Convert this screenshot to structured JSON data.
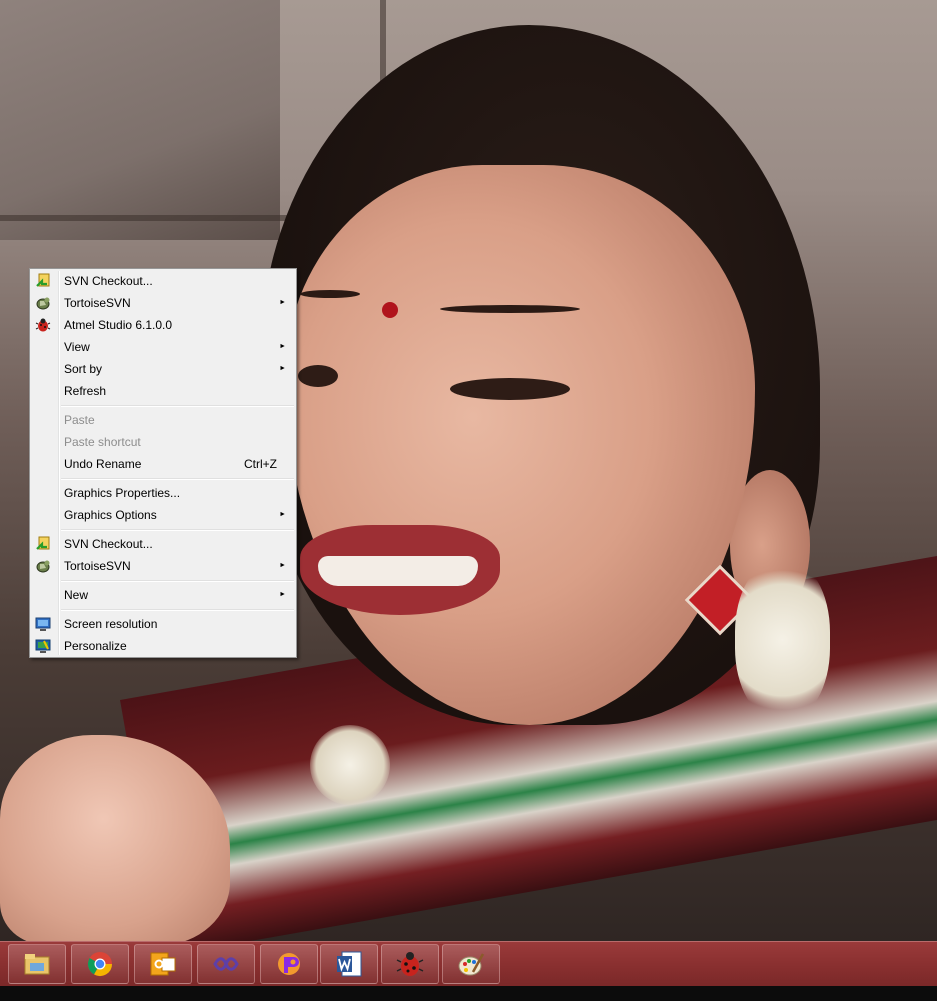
{
  "context_menu": {
    "items": [
      {
        "label": "SVN Checkout...",
        "icon": "svn-checkout-icon",
        "submenu": false
      },
      {
        "label": "TortoiseSVN",
        "icon": "tortoisesvn-icon",
        "submenu": true
      },
      {
        "label": "Atmel Studio 6.1.0.0",
        "icon": "atmel-studio-icon",
        "submenu": false
      },
      {
        "label": "View",
        "submenu": true
      },
      {
        "label": "Sort by",
        "submenu": true
      },
      {
        "label": "Refresh",
        "submenu": false
      },
      {
        "label": "Paste",
        "disabled": true
      },
      {
        "label": "Paste shortcut",
        "disabled": true
      },
      {
        "label": "Undo Rename",
        "shortcut": "Ctrl+Z"
      },
      {
        "label": "Graphics Properties...",
        "submenu": false
      },
      {
        "label": "Graphics Options",
        "submenu": true
      },
      {
        "label": "SVN Checkout...",
        "icon": "svn-checkout-icon",
        "submenu": false
      },
      {
        "label": "TortoiseSVN",
        "icon": "tortoisesvn-icon",
        "submenu": true
      },
      {
        "label": "New",
        "submenu": true
      },
      {
        "label": "Screen resolution",
        "icon": "screen-resolution-icon",
        "submenu": false
      },
      {
        "label": "Personalize",
        "icon": "personalize-icon",
        "submenu": false
      }
    ],
    "submenu_arrow": "►"
  },
  "taskbar": {
    "color": "#8a3030",
    "pinned_apps": [
      {
        "name": "file-explorer-icon"
      },
      {
        "name": "chrome-icon"
      },
      {
        "name": "outlook-icon"
      },
      {
        "name": "visual-studio-icon"
      },
      {
        "name": "paint-shop-icon"
      },
      {
        "name": "word-icon"
      },
      {
        "name": "atmel-studio-icon"
      },
      {
        "name": "paint-icon"
      }
    ]
  }
}
